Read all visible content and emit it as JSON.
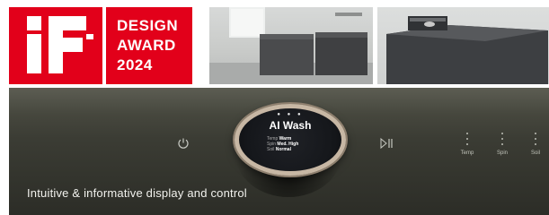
{
  "award": {
    "logo_text": "iF",
    "line1": "DESIGN",
    "line2": "AWARD",
    "line3": "2024",
    "brand_color": "#e2001a"
  },
  "panel": {
    "power_icon": "power-icon",
    "play_pause_icon": "play-pause-icon",
    "dial": {
      "title": "AI Wash",
      "rows": [
        {
          "key": "Temp",
          "value": "Warm"
        },
        {
          "key": "Spin",
          "value": "Med. High"
        },
        {
          "key": "Soil",
          "value": "Normal"
        }
      ]
    },
    "indicators": [
      "Temp",
      "Spin",
      "Soil"
    ],
    "caption": "Intuitive & informative display and control"
  }
}
